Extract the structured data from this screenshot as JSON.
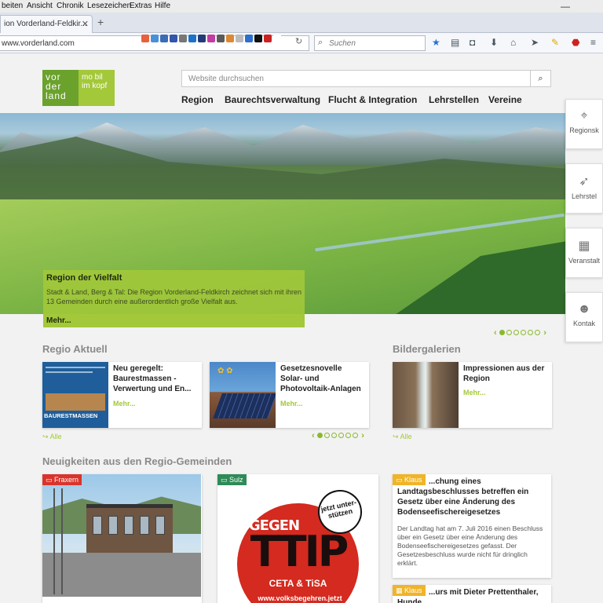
{
  "browser": {
    "menu": [
      "beiten",
      "Ansicht",
      "Chronik",
      "Lesezeichen",
      "Extras",
      "Hilfe"
    ],
    "tab_title": "ion Vorderland-Feldkir...",
    "url": "www.vorderland.com",
    "search_placeholder": "Suchen"
  },
  "site": {
    "logo_left": "vor der land",
    "logo_right": "mo bil im kopf",
    "search_placeholder": "Website durchsuchen",
    "nav": [
      "Region",
      "Baurechtsverwaltung",
      "Flucht & Integration",
      "Lehrstellen",
      "Vereine"
    ],
    "hero": {
      "title": "Region der Vielfalt",
      "text": "Stadt & Land, Berg & Tal: Die Region Vorderland-Feldkirch zeichnet sich mit ihren 13 Gemeinden durch eine außerordentlich große Vielfalt aus.",
      "more": "Mehr..."
    },
    "side_tabs": [
      "Regionsk",
      "Lehrstel",
      "Veranstalt",
      "Kontak"
    ],
    "regio_aktuell": {
      "title": "Regio Aktuell",
      "cards": [
        {
          "title": "Neu geregelt: Baurestmassen - Verwertung und En...",
          "more": "Mehr...",
          "thumb_label": "BAURESTMASSEN"
        },
        {
          "title": "Gesetzesnovelle Solar- und Photovoltaik-Anlagen",
          "more": "Mehr..."
        }
      ],
      "all": "Alle"
    },
    "bildergalerien": {
      "title": "Bildergalerien",
      "card": {
        "title": "Impressionen aus der Region",
        "more": "Mehr..."
      },
      "all": "Alle"
    },
    "gemeinden": {
      "title": "Neuigkeiten aus den Regio-Gemeinden",
      "cards": [
        {
          "tag": "Fraxern"
        },
        {
          "tag": "Sulz",
          "poster": {
            "gegen": "GEGEN",
            "main": "TTIP",
            "sub": "CETA & TiSA",
            "url": "www.volksbegehren.jetzt",
            "badge": "jetzt unter-stützen"
          }
        },
        {
          "tag": "Klaus",
          "title": "...chung eines Landtagsbeschlusses betreffen ein Gesetz über eine Änderung des Bodenseefischereigesetzes",
          "body": "Der Landtag hat am 7. Juli 2016 einen Beschluss über ein Gesetz über eine Änderung des Bodenseefischereigesetzes gefasst. Der Gesetzesbeschluss wurde nicht für dringlich erklärt."
        },
        {
          "tag": "Klaus",
          "title": "...urs mit Dieter Prettenthaler, Hunde"
        }
      ]
    }
  },
  "colors": {
    "brand_green": "#6aa22c",
    "accent_lime": "#a3c83a",
    "tag_red": "#d9342b",
    "tag_green": "#2e8b57",
    "tag_yellow": "#f0b429"
  }
}
